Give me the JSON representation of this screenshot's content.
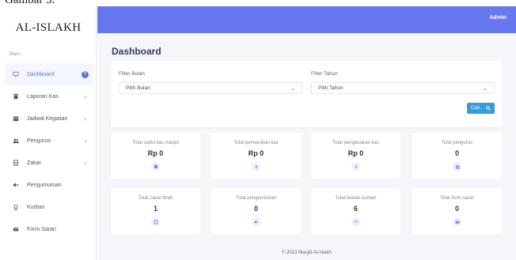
{
  "caption": "Gambar 5.",
  "sidebar": {
    "logo": "AL-ISLAKH",
    "section": "Main",
    "items": [
      {
        "label": "Dashboard",
        "badge": "?"
      },
      {
        "label": "Laporan Kas",
        "chevron": "›"
      },
      {
        "label": "Jadwal Kegiatan",
        "chevron": "›"
      },
      {
        "label": "Pengurus",
        "chevron": "›"
      },
      {
        "label": "Zakat",
        "chevron": "›"
      },
      {
        "label": "Pengumuman"
      },
      {
        "label": "Kurban"
      },
      {
        "label": "Form Saran"
      }
    ]
  },
  "topbar": {
    "user": "Admin"
  },
  "page": {
    "title": "Dashboard"
  },
  "filter": {
    "month_label": "Filter Bulan",
    "month_value": "Pilih Bulan",
    "year_label": "Filter Tahun",
    "year_value": "Pilih Tahun",
    "search_button": "Cari..."
  },
  "stats": [
    {
      "label": "Total saldo kas masjid",
      "value": "Rp 0"
    },
    {
      "label": "Total pemasukan kas",
      "value": "Rp 0"
    },
    {
      "label": "Total pengeluaran kas",
      "value": "Rp 0"
    },
    {
      "label": "Total pengurus",
      "value": "0"
    },
    {
      "label": "Total zakat fitrah",
      "value": "1"
    },
    {
      "label": "Total pengumuman",
      "value": "0"
    },
    {
      "label": "Total hewan kurban",
      "value": "6"
    },
    {
      "label": "Total form saran",
      "value": "0"
    }
  ],
  "footer": "© 2023 Masjid Al-Islakh",
  "colors": {
    "primary": "#6777ef",
    "button": "#3a9bdc",
    "background": "#f4f6f9"
  }
}
